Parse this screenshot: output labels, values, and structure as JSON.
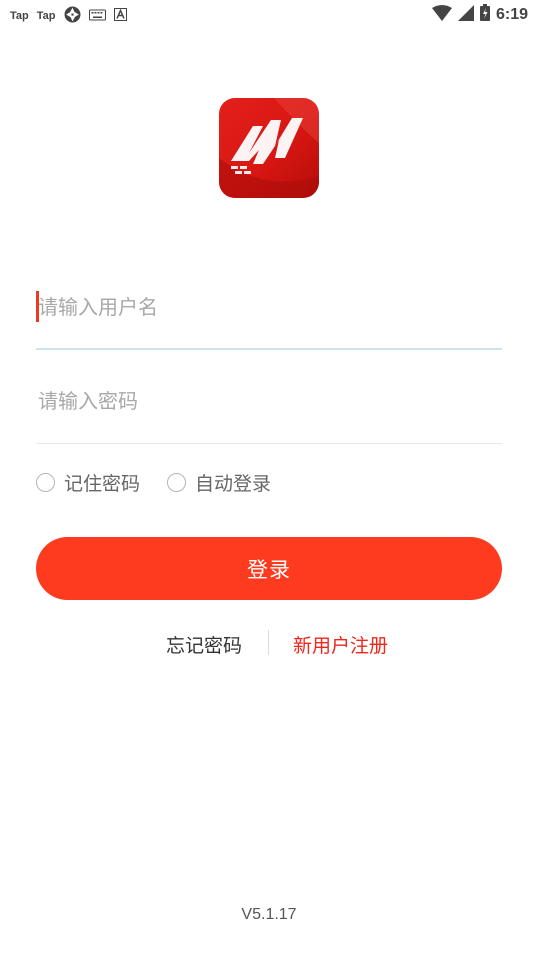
{
  "status_bar": {
    "apps": [
      "Tap",
      "Tap"
    ],
    "time": "6:19"
  },
  "login": {
    "username_placeholder": "请输入用户名",
    "password_placeholder": "请输入密码",
    "remember_label": "记住密码",
    "auto_login_label": "自动登录",
    "login_button": "登录",
    "forgot_link": "忘记密码",
    "register_link": "新用户注册"
  },
  "version": "V5.1.17",
  "colors": {
    "accent": "#ff3b1f",
    "register_link": "#f0261a",
    "logo": "#d81612"
  }
}
